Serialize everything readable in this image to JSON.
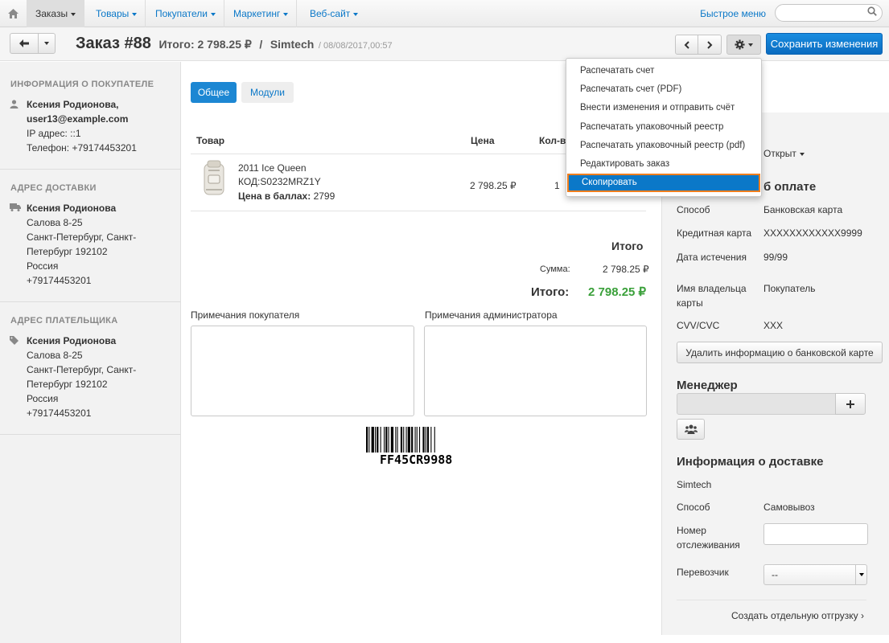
{
  "topnav": {
    "items": [
      {
        "label": "Заказы"
      },
      {
        "label": "Товары"
      },
      {
        "label": "Покупатели"
      },
      {
        "label": "Маркетинг"
      },
      {
        "label": "Веб-сайт"
      }
    ],
    "quick_menu": "Быстрое меню",
    "search_placeholder": ""
  },
  "header": {
    "title": "Заказ #88",
    "total": "Итого: 2 798.25 ₽",
    "separator": "/",
    "company": "Simtech",
    "date": "/ 08/08/2017,00:57",
    "save_label": "Сохранить изменения"
  },
  "sidebar": {
    "customer": {
      "title": "Информация о покупателе",
      "name": "Ксения Родионова,",
      "email": "user13@example.com",
      "ip": "IP адрес: ::1",
      "phone": "Телефон: +79174453201"
    },
    "shipping": {
      "title": "Адрес доставки",
      "name": "Ксения Родионова",
      "line1": "Салова 8-25",
      "line2": "Санкт-Петербург, Санкт-",
      "line3": "Петербург 192102",
      "line4": "Россия",
      "line5": "+79174453201"
    },
    "billing": {
      "title": "Адрес плательщика",
      "name": "Ксения Родионова",
      "line1": "Салова 8-25",
      "line2": "Санкт-Петербург, Санкт-",
      "line3": "Петербург 192102",
      "line4": "Россия",
      "line5": "+79174453201"
    }
  },
  "tabs": [
    {
      "label": "Общее"
    },
    {
      "label": "Модули"
    }
  ],
  "table": {
    "headers": {
      "product": "Товар",
      "price": "Цена",
      "qty": "Кол-в"
    },
    "row": {
      "name": "2011 Ice Queen",
      "code": "КОД:S0232MRZ1Y",
      "points_label": "Цена в баллах:",
      "points_value": "2799",
      "price": "2 798.25 ₽",
      "qty": "1"
    }
  },
  "totals": {
    "title": "Итого",
    "sum_label": "Сумма:",
    "sum_value": "2 798.25 ₽",
    "total_label": "Итого:",
    "total_value": "2 798.25 ₽"
  },
  "notes": {
    "customer_label": "Примечания покупателя",
    "admin_label": "Примечания администратора"
  },
  "barcode": {
    "text": "FF45CR9988"
  },
  "right_panel": {
    "status": "Открыт",
    "payment_title": "б оплате",
    "method_label": "Способ",
    "method_value": "Банковская карта",
    "card_label": "Кредитная карта",
    "card_value": "XXXXXXXXXXXX9999",
    "expiry_label": "Дата истечения",
    "expiry_value": "99/99",
    "holder_label_1": "Имя владельца",
    "holder_label_2": "карты",
    "holder_value": "Покупатель",
    "cvv_label": "CVV/CVC",
    "cvv_value": "XXX",
    "delete_card_button": "Удалить информацию о банковской карте",
    "manager_title": "Менеджер",
    "shipping_title": "Информация о доставке",
    "shipping_company": "Simtech",
    "ship_method_label": "Способ",
    "ship_method_value": "Самовывоз",
    "tracking_label_1": "Номер",
    "tracking_label_2": "отслеживания",
    "carrier_label": "Перевозчик",
    "carrier_value": "--",
    "create_shipment": "Создать отдельную отгрузку ›"
  },
  "dropdown": {
    "items": [
      {
        "label": "Распечатать счет"
      },
      {
        "label": "Распечатать счет (PDF)"
      },
      {
        "label": "Внести изменения и отправить счёт"
      },
      {
        "label": "Распечатать упаковочный реестр"
      },
      {
        "label": "Распечатать упаковочный реестр (pdf)"
      },
      {
        "label": "Редактировать заказ"
      },
      {
        "label": "Скопировать"
      }
    ]
  },
  "colors": {
    "primary": "#0b78c8",
    "total_green": "#3aa03a",
    "highlight_border": "#f07e1d"
  }
}
